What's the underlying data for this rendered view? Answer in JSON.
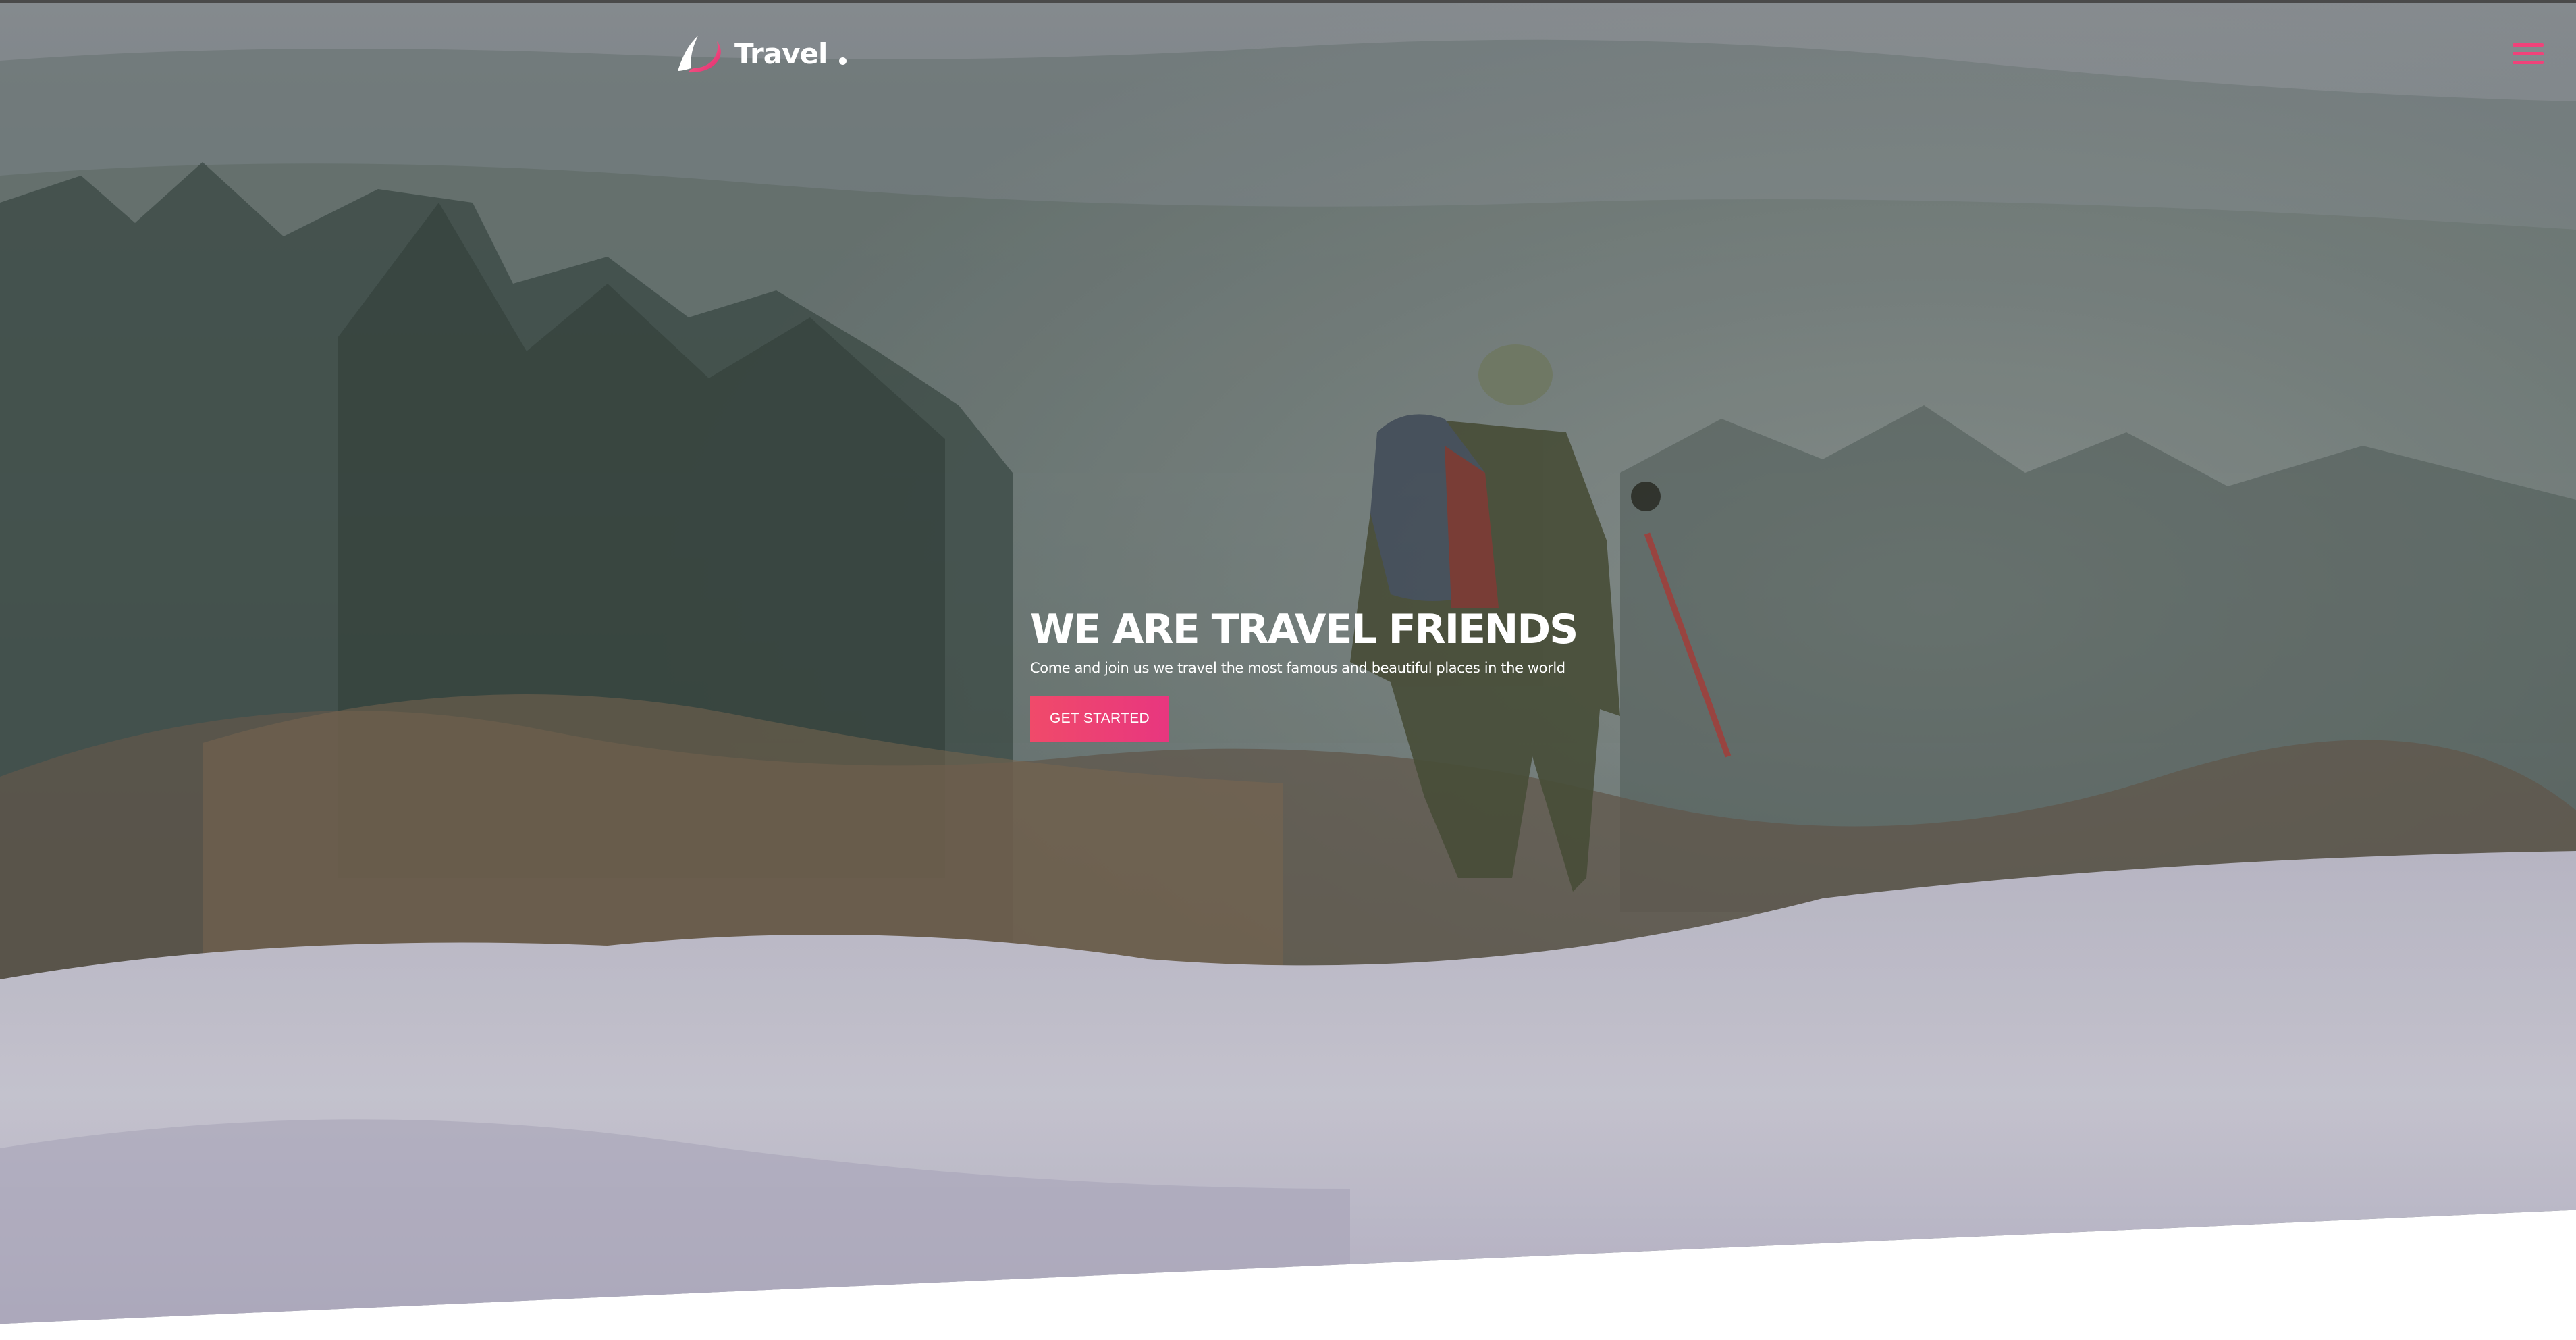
{
  "brand": {
    "name": "Travel",
    "logo_icon": "crescent-logo-icon",
    "accent_color": "#f0427a"
  },
  "header": {
    "menu_icon": "hamburger-menu-icon"
  },
  "hero": {
    "title": "WE ARE TRAVEL FRIENDS",
    "subtitle": "Come and join us we travel the most famous and beautiful places in the world",
    "cta_label": "GET STARTED",
    "background": "hiker-in-snowy-forest-photo"
  }
}
